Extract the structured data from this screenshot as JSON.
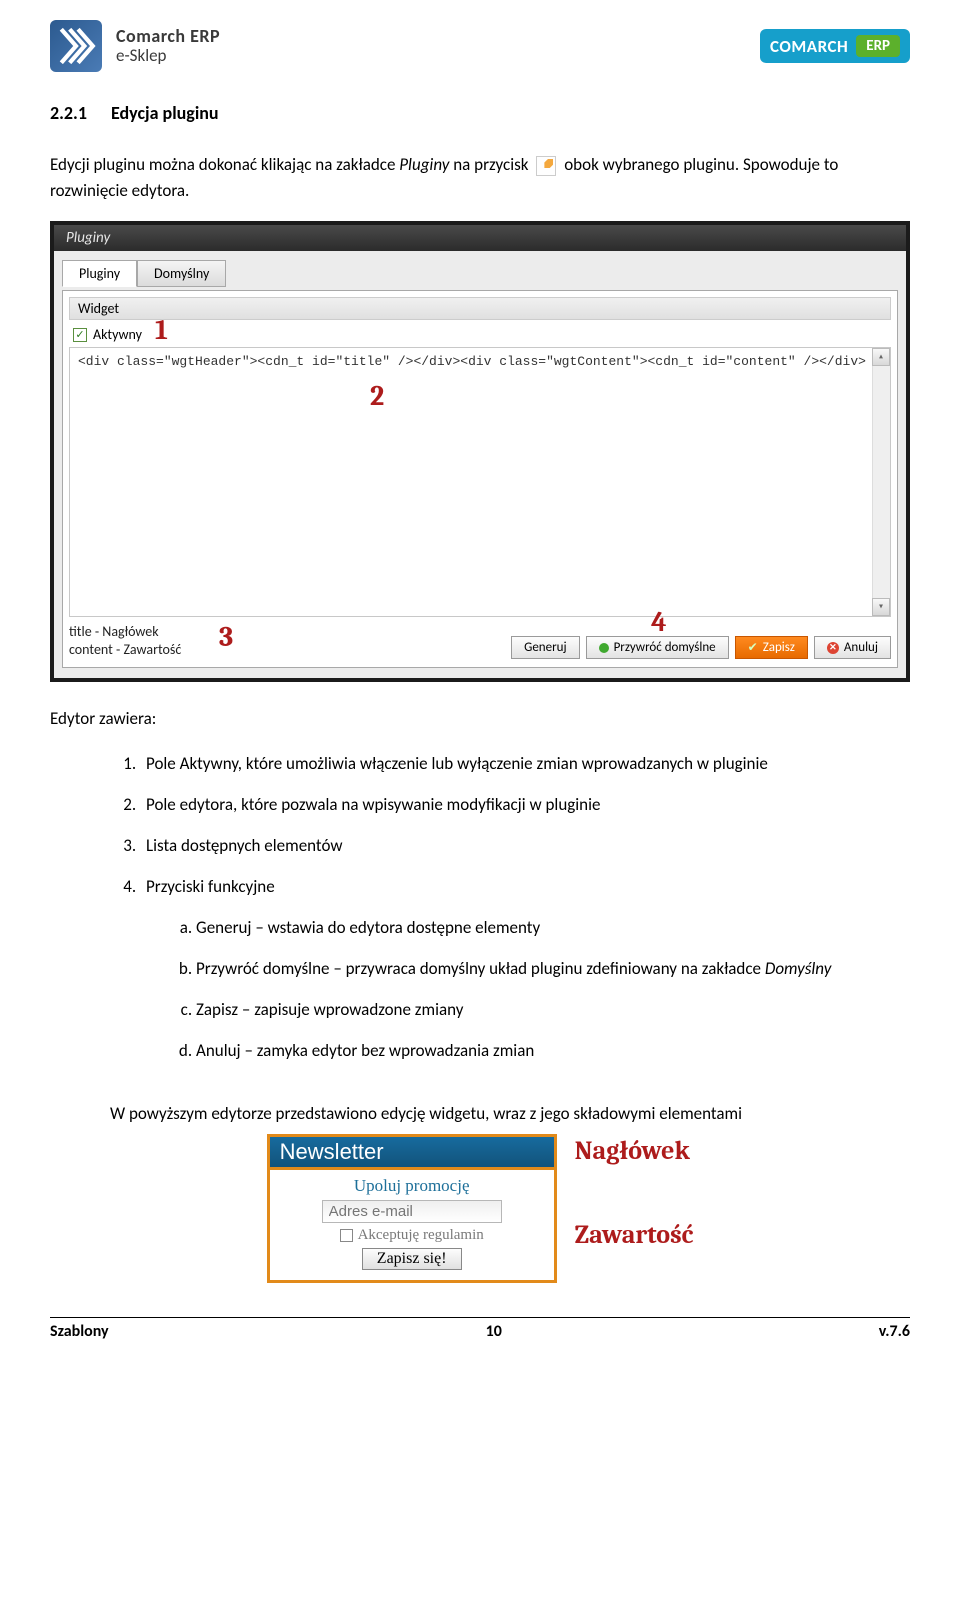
{
  "header": {
    "logo_main": "Comarch ERP",
    "logo_sub": "e-Sklep",
    "badge_main": "COMARCH",
    "badge_erp": "ERP"
  },
  "section": {
    "number": "2.2.1",
    "title": "Edycja pluginu"
  },
  "intro": {
    "part1": "Edycji pluginu można dokonać klikając na zakładce ",
    "pluginy_word": "Pluginy",
    "part2": " na przycisk ",
    "part3": " obok wybranego pluginu. Spowoduje to rozwinięcie edytora."
  },
  "editor": {
    "window_title": "Pluginy",
    "tabs": {
      "pluginy": "Pluginy",
      "domyslny": "Domyślny"
    },
    "fieldset_label": "Widget",
    "checkbox_label": "Aktywny",
    "code_text": "<div class=\"wgtHeader\"><cdn_t id=\"title\" /></div><div class=\"wgtContent\"><cdn_t id=\"content\" /></div>",
    "legend_line1": "title - Nagłówek",
    "legend_line2": "content - Zawartość",
    "buttons": {
      "generuj": "Generuj",
      "przywroc": "Przywróć domyślne",
      "zapisz": "Zapisz",
      "anuluj": "Anuluj"
    },
    "annotations": {
      "a1": "1",
      "a2": "2",
      "a3": "3",
      "a4": "4"
    }
  },
  "list_intro": "Edytor zawiera:",
  "list": {
    "i1": "Pole Aktywny, które umożliwia włączenie lub wyłączenie zmian wprowadzanych w pluginie",
    "i2": "Pole edytora, które pozwala na wpisywanie modyfikacji w pluginie",
    "i3": "Lista dostępnych elementów",
    "i4": "Przyciski funkcyjne",
    "s_a": "Generuj – wstawia do edytora dostępne elementy",
    "s_b_pre": "Przywróć domyślne – przywraca domyślny układ pluginu zdefiniowany na zakładce ",
    "s_b_em": "Domyślny",
    "s_c": "Zapisz – zapisuje wprowadzone zmiany",
    "s_d": "Anuluj – zamyka edytor bez wprowadzania zmian"
  },
  "summary": "W powyższym edytorze przedstawiono edycję widgetu, wraz z jego składowymi elementami",
  "widget": {
    "header": "Newsletter",
    "line1": "Upoluj promocję",
    "placeholder": "Adres e-mail",
    "chk_label": "Akceptuję regulamin",
    "button": "Zapisz się!",
    "side_header": "Nagłówek",
    "side_content": "Zawartość"
  },
  "footer": {
    "left": "Szablony",
    "center": "10",
    "right": "v.7.6"
  }
}
